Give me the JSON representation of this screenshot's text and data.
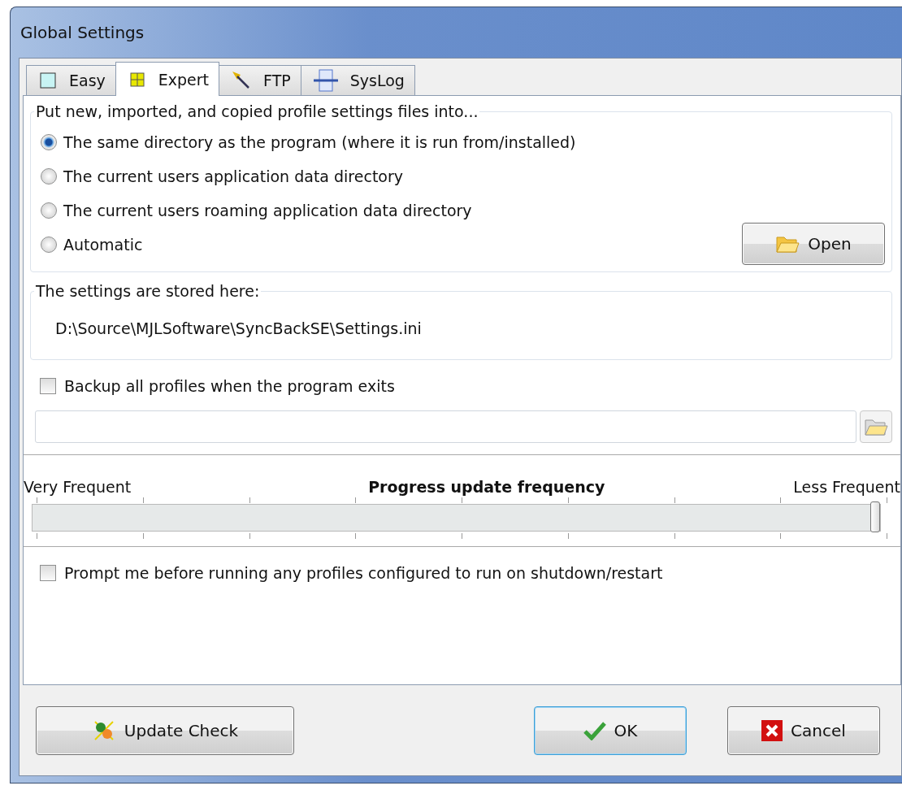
{
  "window": {
    "title": "Global Settings"
  },
  "tabs": [
    {
      "label": "Easy",
      "kind": "easy",
      "selected": false
    },
    {
      "label": "Expert",
      "kind": "expert",
      "selected": true
    },
    {
      "label": "FTP",
      "kind": "ftp",
      "selected": false
    },
    {
      "label": "SysLog",
      "kind": "syslog",
      "selected": false
    }
  ],
  "location_group": {
    "title": "Put new, imported, and copied profile settings files into...",
    "options": [
      {
        "label": "The same directory as the program (where it is run from/installed)",
        "selected": true
      },
      {
        "label": "The current users application data directory",
        "selected": false
      },
      {
        "label": "The current users roaming application data directory",
        "selected": false
      },
      {
        "label": "Automatic",
        "selected": false
      }
    ],
    "open_button": "Open"
  },
  "stored_group": {
    "title": "The settings are stored here:",
    "path": "D:\\Source\\MJLSoftware\\SyncBackSE\\Settings.ini"
  },
  "backup_checkbox": {
    "label": "Backup all profiles when the program exits",
    "checked": false
  },
  "slider": {
    "left_label": "Very Frequent",
    "title": "Progress update frequency",
    "right_label": "Less Frequent",
    "level": 1
  },
  "prompt_checkbox": {
    "label": "Prompt me before running any profiles configured to run on shutdown/restart",
    "checked": false
  },
  "buttons": [
    {
      "label": "Update Check",
      "kind": "update"
    },
    {
      "label": "OK",
      "kind": "ok"
    },
    {
      "label": "Cancel",
      "kind": "cancel"
    }
  ]
}
